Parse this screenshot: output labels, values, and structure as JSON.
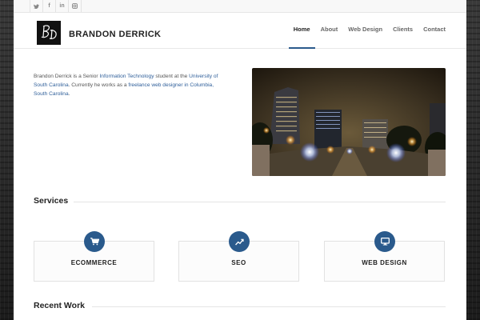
{
  "social": {
    "icons": [
      "twitter-icon",
      "facebook-icon",
      "linkedin-icon",
      "instagram-icon"
    ],
    "glyphs": [
      "𝕥",
      "f",
      "in",
      "◙"
    ]
  },
  "header": {
    "logo_text": "BRANDON DERRICK",
    "nav": [
      {
        "label": "Home",
        "active": true
      },
      {
        "label": "About",
        "active": false
      },
      {
        "label": "Web Design",
        "active": false
      },
      {
        "label": "Clients",
        "active": false
      },
      {
        "label": "Contact",
        "active": false
      }
    ]
  },
  "intro": {
    "part1": "Brandon Derrick is a Senior ",
    "link1": "Information Technology",
    "part2": " student at the ",
    "link2": "University of South Carolina",
    "part3": ".  Currently he works as a ",
    "link3": "freelance web designer in Columbia, South Carolina",
    "part4": "."
  },
  "services": {
    "title": "Services",
    "items": [
      {
        "label": "ECOMMERCE",
        "icon": "cart-icon"
      },
      {
        "label": "SEO",
        "icon": "trend-chart-icon"
      },
      {
        "label": "WEB DESIGN",
        "icon": "monitor-icon"
      }
    ]
  },
  "recent_work": {
    "title": "Recent Work"
  },
  "colors": {
    "accent": "#2a5a8c",
    "link": "#2f5f9a"
  }
}
